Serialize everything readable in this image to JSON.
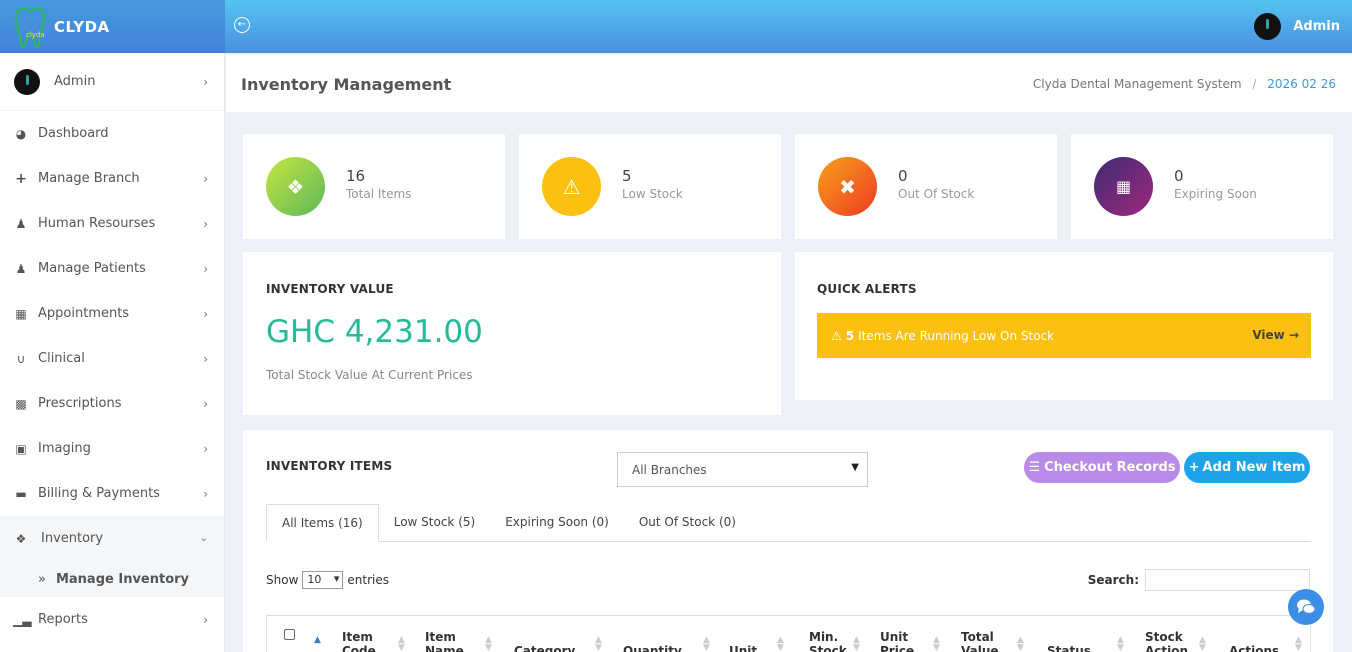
{
  "brand": {
    "name": "CLYDA",
    "logo_text": "clyda"
  },
  "topbar": {
    "collapse_icon": "arrow-left-circle-icon",
    "user_name": "Admin"
  },
  "sidebar": {
    "user": {
      "name": "Admin"
    },
    "items": [
      {
        "label": "Dashboard",
        "icon": "dashboard-icon"
      },
      {
        "label": "Manage Branch",
        "icon": "plus-icon"
      },
      {
        "label": "Human Resourses",
        "icon": "user-tie-icon"
      },
      {
        "label": "Manage Patients",
        "icon": "users-icon"
      },
      {
        "label": "Appointments",
        "icon": "calendar-icon"
      },
      {
        "label": "Clinical",
        "icon": "stethoscope-icon"
      },
      {
        "label": "Prescriptions",
        "icon": "medkit-icon"
      },
      {
        "label": "Imaging",
        "icon": "image-icon"
      },
      {
        "label": "Billing & Payments",
        "icon": "credit-card-icon"
      },
      {
        "label": "Inventory",
        "icon": "cubes-icon"
      },
      {
        "label": "Reports",
        "icon": "bar-chart-icon"
      }
    ],
    "submenu": {
      "label": "Manage Inventory",
      "marker": "»"
    }
  },
  "header": {
    "title": "Inventory Management",
    "breadcrumb_system": "Clyda Dental Management System",
    "breadcrumb_sep": "/",
    "breadcrumb_date": "2026 02 26"
  },
  "stats": [
    {
      "value": "16",
      "label": "Total Items",
      "icon": "cubes-icon",
      "color": "#8cc63f"
    },
    {
      "value": "5",
      "label": "Low Stock",
      "icon": "warning-icon",
      "color": "#fcc010"
    },
    {
      "value": "0",
      "label": "Out Of Stock",
      "icon": "times-circle-icon",
      "color": "#f04e23"
    },
    {
      "value": "0",
      "label": "Expiring Soon",
      "icon": "calendar-times-icon",
      "color": "#6a2c91"
    }
  ],
  "inventory_value": {
    "title": "INVENTORY VALUE",
    "amount": "GHC 4,231.00",
    "subtitle": "Total Stock Value At Current Prices"
  },
  "quick_alerts": {
    "title": "QUICK ALERTS",
    "count": "5",
    "message": "Items Are Running Low On Stock",
    "view_label": "View →"
  },
  "inventory_items": {
    "title": "INVENTORY ITEMS",
    "branch_select": "All Branches",
    "checkout_label": "Checkout Records",
    "add_label": "Add New Item",
    "tabs": [
      "All Items (16)",
      "Low Stock (5)",
      "Expiring Soon (0)",
      "Out Of Stock (0)"
    ],
    "show_label": "Show",
    "entries_value": "10",
    "entries_label": "entries",
    "search_label": "Search:",
    "columns": [
      {
        "l1": "Item",
        "l2": "Code"
      },
      {
        "l1": "Item",
        "l2": "Name"
      },
      {
        "l1": "",
        "l2": "Category"
      },
      {
        "l1": "",
        "l2": "Quantity"
      },
      {
        "l1": "",
        "l2": "Unit"
      },
      {
        "l1": "Min.",
        "l2": "Stock"
      },
      {
        "l1": "Unit",
        "l2": "Price"
      },
      {
        "l1": "Total",
        "l2": "Value"
      },
      {
        "l1": "",
        "l2": "Status"
      },
      {
        "l1": "Stock",
        "l2": "Action"
      },
      {
        "l1": "",
        "l2": "Actions"
      }
    ]
  },
  "colors": {
    "accent": "#4a90e2",
    "success": "#26b99a",
    "warning": "#fcc010",
    "checkout": "#b88be8",
    "add": "#1fa3e8"
  }
}
